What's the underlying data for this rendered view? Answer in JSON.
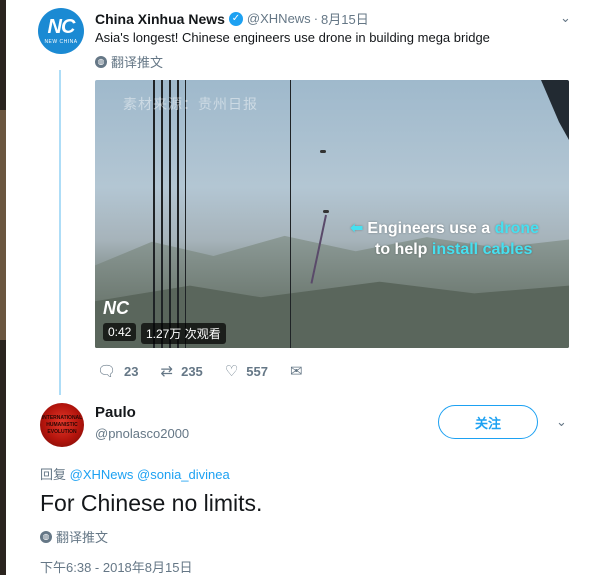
{
  "tweet": {
    "author_name": "China Xinhua News",
    "verified_glyph": "✓",
    "handle": "@XHNews",
    "separator": "·",
    "date": "8月15日",
    "text": "Asia's longest! Chinese engineers use drone in building mega bridge",
    "translate_label": "翻译推文",
    "avatar_text": "NC",
    "avatar_sub": "NEW CHINA",
    "video": {
      "watermark": "素材来源：贵州日报",
      "overlay_line1_pre": "Engineers use a ",
      "overlay_line1_hl": "drone",
      "overlay_line2_pre": "to help ",
      "overlay_line2_hl": "install cables",
      "overlay_arrow": "⬅",
      "logo_text": "NC",
      "duration": "0:42",
      "views": "1.27万 次观看"
    },
    "stats": {
      "replies": "23",
      "retweets": "235",
      "likes": "557"
    },
    "icons": {
      "reply": "💬",
      "retweet": "⇄",
      "like": "♡",
      "message": "✉",
      "chevron": "⌄"
    }
  },
  "reply": {
    "author_name": "Paulo",
    "handle": "@pnolasco2000",
    "follow_label": "关注",
    "reply_prefix": "回复",
    "mention1": "@XHNews",
    "mention2": "@sonia_divinea",
    "text": "For Chinese no limits.",
    "translate_label": "翻译推文",
    "timestamp": "下午6:38 - 2018年8月15日",
    "avatar_lines": [
      "INTERNATIONAL",
      "HUMANISTIC",
      "EVOLUTION"
    ]
  },
  "colors": {
    "accent": "#1da1f2",
    "muted": "#657786",
    "text": "#14171a",
    "thread_line": "#aeddf7"
  }
}
